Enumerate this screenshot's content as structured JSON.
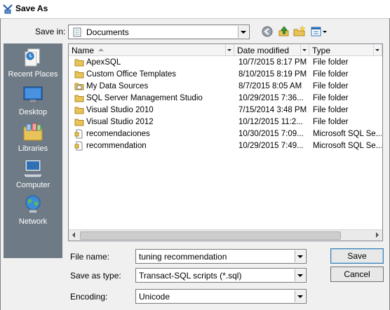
{
  "window": {
    "title": "Save As"
  },
  "save_in": {
    "label": "Save in:",
    "value": "Documents"
  },
  "toolbar": {
    "back_icon": "back-arrow-icon",
    "up_icon": "up-one-level-icon",
    "new_folder_icon": "new-folder-icon",
    "views_icon": "view-menu-icon"
  },
  "places": [
    {
      "label": "Recent Places",
      "icon": "recent-places-icon"
    },
    {
      "label": "Desktop",
      "icon": "desktop-icon"
    },
    {
      "label": "Libraries",
      "icon": "libraries-icon"
    },
    {
      "label": "Computer",
      "icon": "computer-icon"
    },
    {
      "label": "Network",
      "icon": "network-icon"
    }
  ],
  "columns": {
    "name": "Name",
    "date": "Date modified",
    "type": "Type"
  },
  "files": [
    {
      "name": "ApexSQL",
      "date": "10/7/2015 8:17 PM",
      "type": "File folder",
      "icon": "folder"
    },
    {
      "name": "Custom Office Templates",
      "date": "8/10/2015 8:19 PM",
      "type": "File folder",
      "icon": "folder"
    },
    {
      "name": "My Data Sources",
      "date": "8/7/2015 8:05 AM",
      "type": "File folder",
      "icon": "datasource-folder"
    },
    {
      "name": "SQL Server Management Studio",
      "date": "10/29/2015 7:36...",
      "type": "File folder",
      "icon": "folder"
    },
    {
      "name": "Visual Studio 2010",
      "date": "7/15/2014 3:48 PM",
      "type": "File folder",
      "icon": "folder"
    },
    {
      "name": "Visual Studio 2012",
      "date": "10/12/2015 11:2...",
      "type": "File folder",
      "icon": "folder"
    },
    {
      "name": "recomendaciones",
      "date": "10/30/2015 7:09...",
      "type": "Microsoft SQL Se...",
      "icon": "sql-file"
    },
    {
      "name": "recommendation",
      "date": "10/29/2015 7:49...",
      "type": "Microsoft SQL Se...",
      "icon": "sql-file"
    }
  ],
  "file_name": {
    "label": "File name:",
    "value": "tuning recommendation"
  },
  "save_as_type": {
    "label": "Save as type:",
    "value": "Transact-SQL scripts (*.sql)"
  },
  "encoding": {
    "label": "Encoding:",
    "value": "Unicode"
  },
  "buttons": {
    "save": "Save",
    "cancel": "Cancel"
  },
  "colors": {
    "places_bg": "#6e7a85",
    "folder": "#e8c35a",
    "default_button_border": "#3c7fb1"
  }
}
